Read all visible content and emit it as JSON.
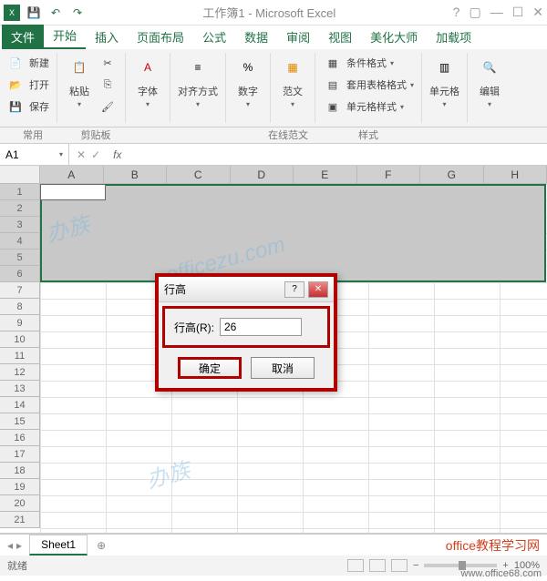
{
  "window": {
    "title": "工作簿1 - Microsoft Excel"
  },
  "qat": {
    "excel": "X⁝",
    "save": "💾",
    "undo": "↶",
    "redo": "↷"
  },
  "tabs": {
    "file": "文件",
    "home": "开始",
    "insert": "插入",
    "page_layout": "页面布局",
    "formulas": "公式",
    "data": "数据",
    "review": "审阅",
    "view": "视图",
    "beautify": "美化大师",
    "addins": "加载项"
  },
  "ribbon": {
    "new": "新建",
    "open": "打开",
    "save": "保存",
    "common": "常用",
    "paste": "粘贴",
    "clipboard": "剪贴板",
    "font": "字体",
    "align": "对齐方式",
    "number": "数字",
    "paradigm": "范文",
    "online_paradigm": "在线范文",
    "cond_format": "条件格式",
    "table_format": "套用表格格式",
    "cell_styles": "单元格样式",
    "styles": "样式",
    "cells": "单元格",
    "editing": "编辑"
  },
  "formula_bar": {
    "cell_ref": "A1",
    "fx": "fx"
  },
  "columns": [
    "A",
    "B",
    "C",
    "D",
    "E",
    "F",
    "G",
    "H"
  ],
  "rows": [
    "1",
    "2",
    "3",
    "4",
    "5",
    "6",
    "7",
    "8",
    "9",
    "10",
    "11",
    "12",
    "13",
    "14",
    "15",
    "16",
    "17",
    "18",
    "19",
    "20",
    "21"
  ],
  "selected_rows": [
    1,
    2,
    3,
    4,
    5,
    6
  ],
  "dialog": {
    "title": "行高",
    "label": "行高(R):",
    "value": "26",
    "ok": "确定",
    "cancel": "取消",
    "help": "?"
  },
  "sheet": {
    "name": "Sheet1",
    "add": "⊕"
  },
  "brand": "office教程学习网",
  "status": {
    "ready": "就绪",
    "zoom": "100%"
  },
  "url": "www.office68.com",
  "chart_data": null
}
